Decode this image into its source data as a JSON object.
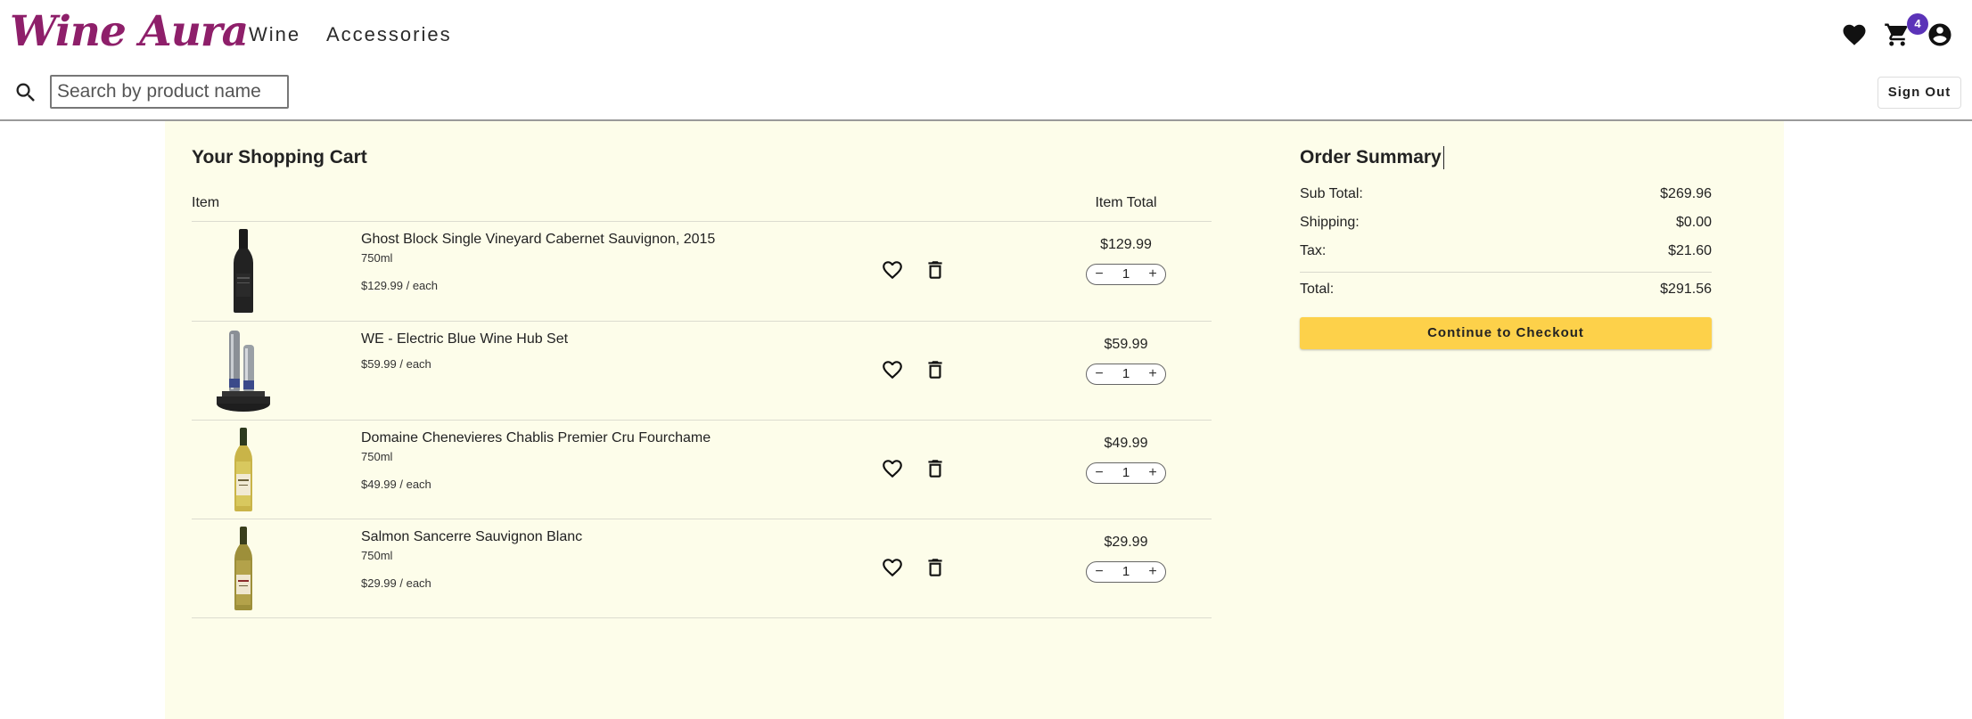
{
  "header": {
    "logo_text": "Wine Aura",
    "nav": [
      {
        "label": "Wine"
      },
      {
        "label": "Accessories"
      }
    ],
    "cart_badge_count": "4",
    "icons": {
      "wishlist": "heart-icon",
      "cart": "shopping-cart-icon",
      "account": "account-circle-icon"
    }
  },
  "search": {
    "placeholder": "Search by product name",
    "value": "",
    "signout_label": "Sign Out"
  },
  "cart": {
    "title": "Your Shopping Cart",
    "col_item": "Item",
    "col_total": "Item Total",
    "items": [
      {
        "name": "Ghost Block Single Vineyard Cabernet Sauvignon, 2015",
        "size": "750ml",
        "unit_price": "$129.99 / each",
        "total": "$129.99",
        "quantity": "1",
        "image": "red-wine-bottle"
      },
      {
        "name": "WE - Electric Blue Wine Hub Set",
        "size": "",
        "unit_price": "$59.99 / each",
        "total": "$59.99",
        "quantity": "1",
        "image": "electric-wine-opener-set"
      },
      {
        "name": "Domaine Chenevieres Chablis Premier Cru Fourchame",
        "size": "750ml",
        "unit_price": "$49.99 / each",
        "total": "$49.99",
        "quantity": "1",
        "image": "white-wine-bottle"
      },
      {
        "name": "Salmon Sancerre Sauvignon Blanc",
        "size": "750ml",
        "unit_price": "$29.99 / each",
        "total": "$29.99",
        "quantity": "1",
        "image": "white-wine-bottle-label"
      }
    ]
  },
  "summary": {
    "title": "Order Summary",
    "subtotal_label": "Sub Total:",
    "subtotal": "$269.96",
    "shipping_label": "Shipping:",
    "shipping": "$0.00",
    "tax_label": "Tax:",
    "tax": "$21.60",
    "total_label": "Total:",
    "total": "$291.56",
    "checkout_label": "Continue to Checkout"
  },
  "colors": {
    "brand": "#8e1f6a",
    "panel": "#fdfdea",
    "checkout": "#fdd14a",
    "badge": "#5b33b8"
  }
}
